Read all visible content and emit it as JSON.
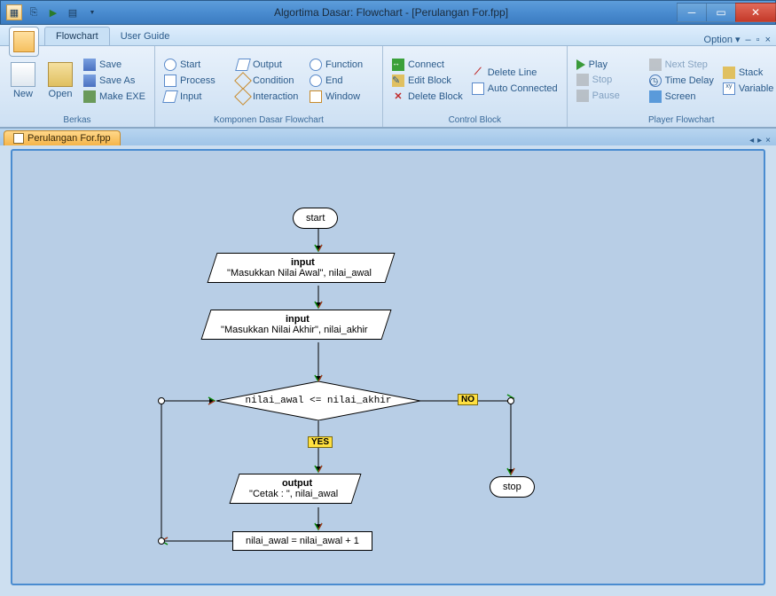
{
  "window": {
    "title": "Algortima Dasar: Flowchart - [Perulangan For.fpp]",
    "option_label": "Option"
  },
  "tabs": {
    "flowchart": "Flowchart",
    "user_guide": "User Guide",
    "file_tab": "Perulangan For.fpp"
  },
  "ribbon": {
    "berkas": {
      "label": "Berkas",
      "new": "New",
      "open": "Open",
      "save": "Save",
      "save_as": "Save As",
      "make_exe": "Make EXE"
    },
    "komponen": {
      "label": "Komponen Dasar Flowchart",
      "start": "Start",
      "process": "Process",
      "input": "Input",
      "output": "Output",
      "condition": "Condition",
      "interaction": "Interaction",
      "function": "Function",
      "end": "End",
      "window": "Window"
    },
    "control": {
      "label": "Control Block",
      "connect": "Connect",
      "edit_block": "Edit Block",
      "delete_block": "Delete Block",
      "delete_line": "Delete Line",
      "auto_connected": "Auto Connected"
    },
    "player": {
      "label": "Player Flowchart",
      "play": "Play",
      "stop": "Stop",
      "pause": "Pause",
      "next_step": "Next Step",
      "time_delay": "Time Delay",
      "screen": "Screen",
      "stack": "Stack",
      "variable": "Variable"
    }
  },
  "flowchart": {
    "start": "start",
    "stop": "stop",
    "input1_label": "input",
    "input1_text": "\"Masukkan Nilai Awal\", nilai_awal",
    "input2_label": "input",
    "input2_text": "\"Masukkan Nilai Akhir\", nilai_akhir",
    "decision": "nilai_awal <= nilai_akhir",
    "yes": "YES",
    "no": "NO",
    "output_label": "output",
    "output_text": "\"Cetak : \", nilai_awal",
    "process": "nilai_awal = nilai_awal + 1"
  }
}
